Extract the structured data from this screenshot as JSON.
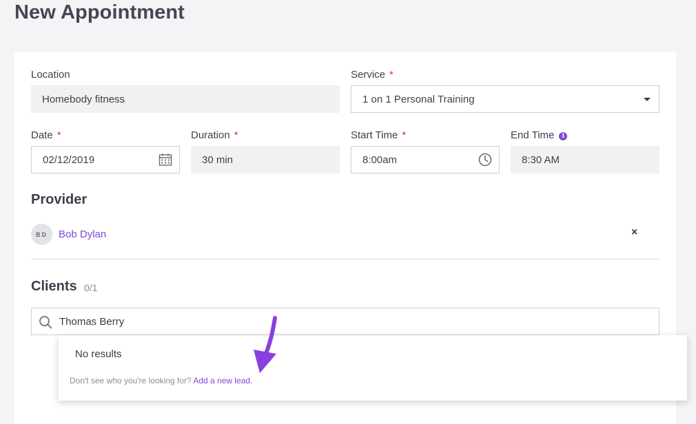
{
  "page": {
    "title": "New Appointment"
  },
  "form": {
    "location": {
      "label": "Location",
      "value": "Homebody fitness"
    },
    "service": {
      "label": "Service",
      "required_mark": "*",
      "value": "1 on 1 Personal Training"
    },
    "date": {
      "label": "Date",
      "required_mark": "*",
      "value": "02/12/2019"
    },
    "duration": {
      "label": "Duration",
      "required_mark": "*",
      "value": "30 min"
    },
    "start_time": {
      "label": "Start Time",
      "required_mark": "*",
      "value": "8:00am"
    },
    "end_time": {
      "label": "End Time",
      "info_icon": "i",
      "value": "8:30 AM"
    }
  },
  "provider": {
    "title": "Provider",
    "initials": "BD",
    "name": "Bob Dylan",
    "remove_label": "×"
  },
  "clients": {
    "title": "Clients",
    "count": "0/1",
    "search_value": "Thomas Berry",
    "dropdown": {
      "no_results": "No results",
      "hint_text": "Don't see who you're looking for?",
      "add_link": "Add a new lead."
    }
  },
  "colors": {
    "accent": "#7e47d3",
    "required": "#d0334a",
    "annotation_arrow": "#8a3fe0"
  },
  "icons": {
    "service_dropdown": "caret-down-icon",
    "date": "calendar-icon",
    "start_time": "clock-icon",
    "end_time_info": "info-icon",
    "search": "search-icon",
    "remove_provider": "close-icon",
    "annotation": "arrow-annotation"
  }
}
